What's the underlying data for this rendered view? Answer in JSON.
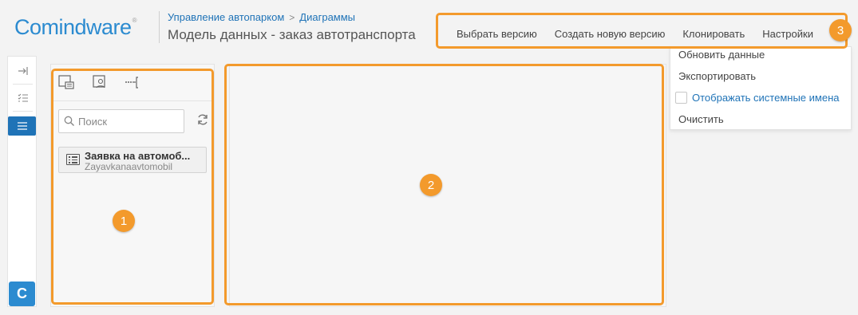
{
  "header": {
    "logo_text": "Comindware",
    "breadcrumbs": [
      "Управление автопарком",
      "Диаграммы"
    ],
    "breadcrumb_separator": ">",
    "title": "Модель данных - заказ автотранспорта"
  },
  "toolbar": {
    "items": [
      "Выбрать версию",
      "Создать новую версию",
      "Клонировать",
      "Настройки"
    ]
  },
  "dropdown": {
    "refresh": "Обновить данные",
    "export": "Экспортировать",
    "show_system_names": "Отображать системные имена",
    "show_system_names_checked": false,
    "clear": "Очистить"
  },
  "rail": {
    "icons": [
      "collapse-panel-icon",
      "checklist-icon",
      "list-icon"
    ],
    "active_index": 2,
    "app_badge": "C"
  },
  "panel": {
    "search_placeholder": "Поиск",
    "object_item": {
      "title": "Заявка на автомоб...",
      "system_name": "Zayavkanaavtomobil"
    }
  },
  "callouts": [
    "1",
    "2",
    "3"
  ],
  "colors": {
    "accent": "#1f73b7",
    "callout": "#f39a2c"
  }
}
